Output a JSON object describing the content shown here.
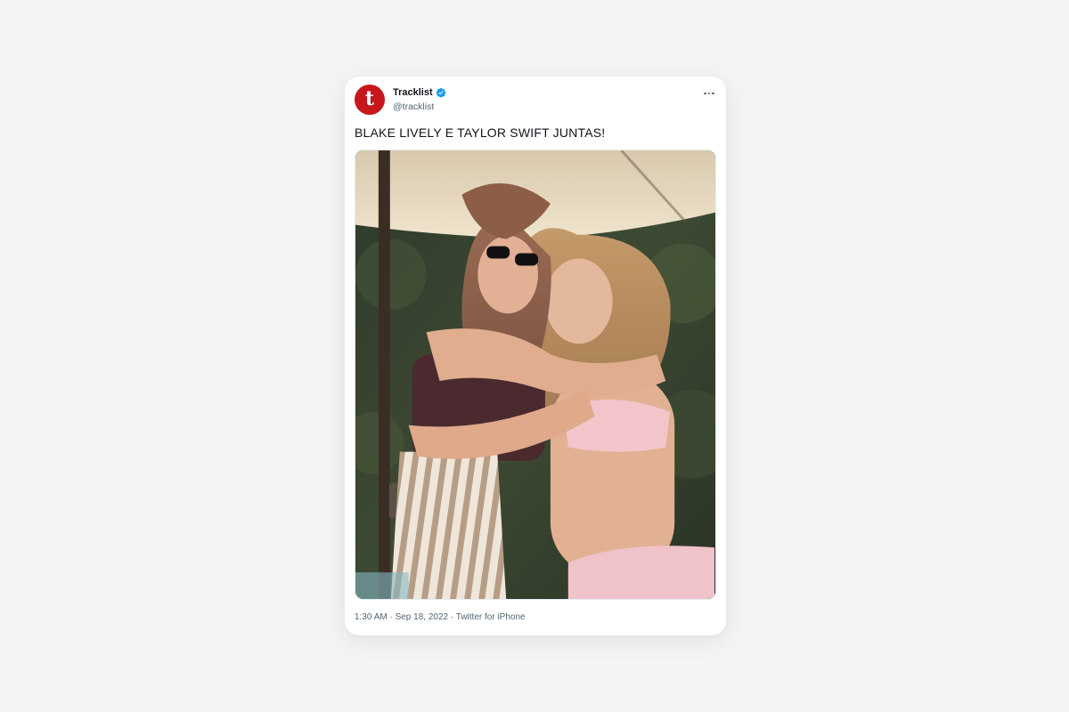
{
  "tweet": {
    "author": {
      "display_name": "Tracklist",
      "handle": "@tracklist",
      "avatar_letter": "t",
      "avatar_color": "#c8161d",
      "verified": true,
      "verified_color": "#1d9bf0"
    },
    "text": "BLAKE LIVELY E TAYLOR SWIFT JUNTAS!",
    "media": {
      "type": "photo",
      "icon": "photo-icon"
    },
    "meta": "1:30 AM · Sep 18, 2022 · Twitter for iPhone",
    "menu_icon": "more-horizontal-icon"
  }
}
